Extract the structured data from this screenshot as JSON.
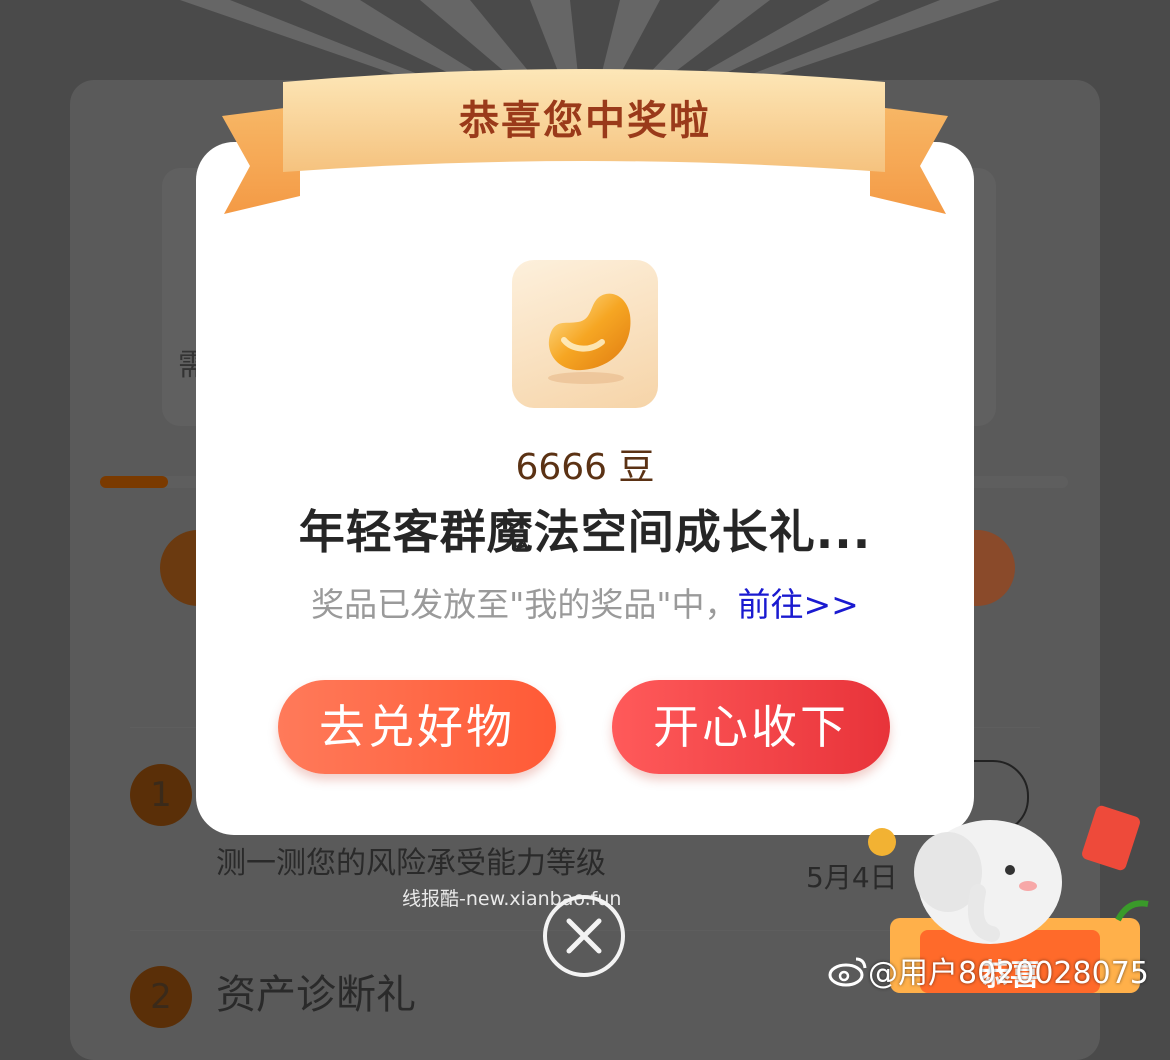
{
  "background": {
    "task1": {
      "number": "1",
      "subtitle": "测一测您的风险承受能力等级",
      "date": "5月4日"
    },
    "task2": {
      "number": "2",
      "title": "资产诊断礼"
    },
    "tile_left_char": "需",
    "progress_fraction": 0.07
  },
  "modal": {
    "title": "恭喜您中奖啦",
    "prize_amount": "6666 豆",
    "prize_name": "年轻客群魔法空间成长礼...",
    "note_text": "奖品已发放至\"我的奖品\"中，",
    "note_link": "前往>>",
    "buttons": {
      "exchange": "去兑好物",
      "accept": "开心收下"
    }
  },
  "overlay": {
    "site_watermark": "线报酷-new.xianbao.fun",
    "weibo_user": "@用户8020028075",
    "mascot_banner": "恭喜"
  },
  "colors": {
    "accept_button": "#e8333a",
    "exchange_button": "#ff5a36",
    "link": "#1a1ad0",
    "ribbon": "#f7c98a"
  },
  "icons": {
    "prize": "golden-bean-icon",
    "close": "close-circle-icon",
    "weibo": "weibo-logo-icon"
  }
}
